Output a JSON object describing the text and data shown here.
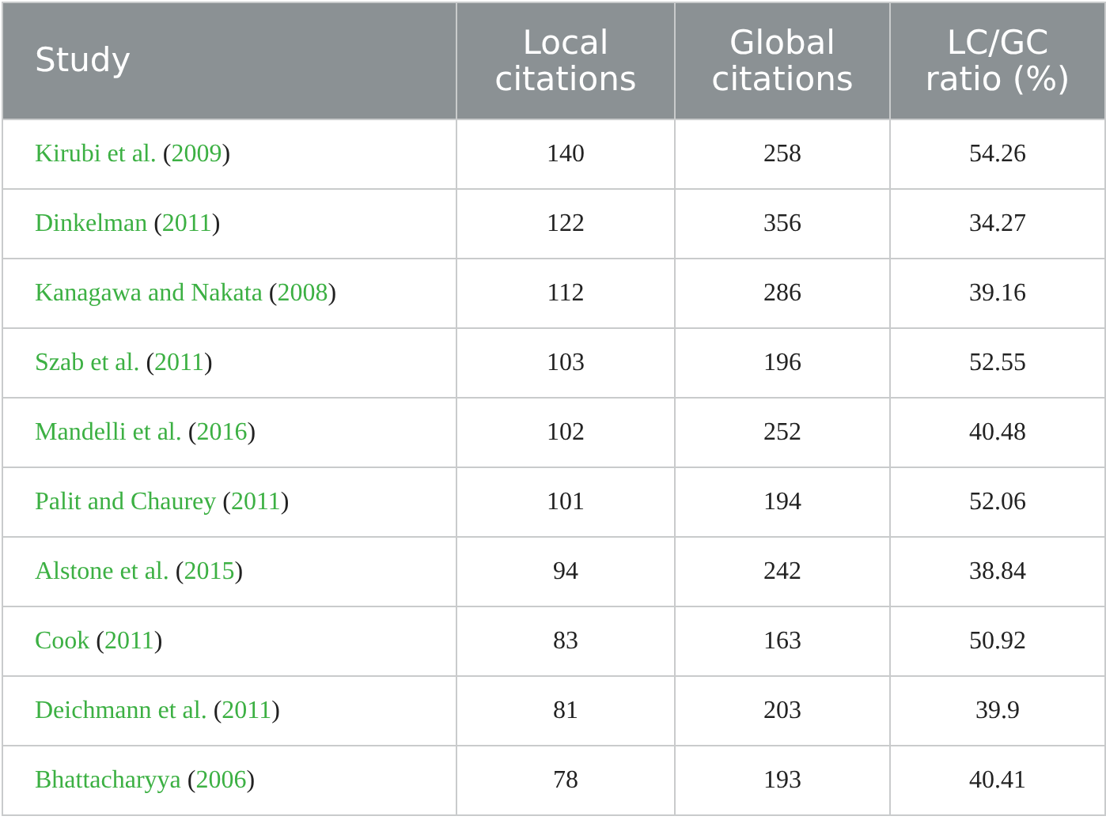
{
  "table": {
    "columns": [
      {
        "label": "Study"
      },
      {
        "label": "Local citations"
      },
      {
        "label": "Global citations"
      },
      {
        "label": "LC/GC ratio (%)"
      }
    ],
    "rows": [
      {
        "study": [
          {
            "text": "Kirubi et al.",
            "link": true
          },
          {
            "text": " (",
            "link": false
          },
          {
            "text": "2009",
            "link": true
          },
          {
            "text": ")",
            "link": false
          }
        ],
        "local": "140",
        "global": "258",
        "ratio": "54.26"
      },
      {
        "study": [
          {
            "text": "Dinkelman",
            "link": true
          },
          {
            "text": " (",
            "link": false
          },
          {
            "text": "2011",
            "link": true
          },
          {
            "text": ")",
            "link": false
          }
        ],
        "local": "122",
        "global": "356",
        "ratio": "34.27"
      },
      {
        "study": [
          {
            "text": "Kanagawa and Nakata",
            "link": true
          },
          {
            "text": " (",
            "link": false
          },
          {
            "text": "2008",
            "link": true
          },
          {
            "text": ")",
            "link": false
          }
        ],
        "local": "112",
        "global": "286",
        "ratio": "39.16"
      },
      {
        "study": [
          {
            "text": "Szab et al.",
            "link": true
          },
          {
            "text": " (",
            "link": false
          },
          {
            "text": "2011",
            "link": true
          },
          {
            "text": ")",
            "link": false
          }
        ],
        "local": "103",
        "global": "196",
        "ratio": "52.55"
      },
      {
        "study": [
          {
            "text": "Mandelli et al.",
            "link": true
          },
          {
            "text": " (",
            "link": false
          },
          {
            "text": "2016",
            "link": true
          },
          {
            "text": ")",
            "link": false
          }
        ],
        "local": "102",
        "global": "252",
        "ratio": "40.48"
      },
      {
        "study": [
          {
            "text": "Palit and Chaurey",
            "link": true
          },
          {
            "text": " (",
            "link": false
          },
          {
            "text": "2011",
            "link": true
          },
          {
            "text": ")",
            "link": false
          }
        ],
        "local": "101",
        "global": "194",
        "ratio": "52.06"
      },
      {
        "study": [
          {
            "text": "Alstone et al.",
            "link": true
          },
          {
            "text": " (",
            "link": false
          },
          {
            "text": "2015",
            "link": true
          },
          {
            "text": ")",
            "link": false
          }
        ],
        "local": "94",
        "global": "242",
        "ratio": "38.84"
      },
      {
        "study": [
          {
            "text": "Cook",
            "link": true
          },
          {
            "text": " (",
            "link": false
          },
          {
            "text": "2011",
            "link": true
          },
          {
            "text": ")",
            "link": false
          }
        ],
        "local": "83",
        "global": "163",
        "ratio": "50.92"
      },
      {
        "study": [
          {
            "text": "Deichmann et al.",
            "link": true
          },
          {
            "text": " (",
            "link": false
          },
          {
            "text": "2011",
            "link": true
          },
          {
            "text": ")",
            "link": false
          }
        ],
        "local": "81",
        "global": "203",
        "ratio": "39.9"
      },
      {
        "study": [
          {
            "text": "Bhattacharyya",
            "link": true
          },
          {
            "text": " (",
            "link": false
          },
          {
            "text": "2006",
            "link": true
          },
          {
            "text": ")",
            "link": false
          }
        ],
        "local": "78",
        "global": "193",
        "ratio": "40.41"
      }
    ]
  }
}
